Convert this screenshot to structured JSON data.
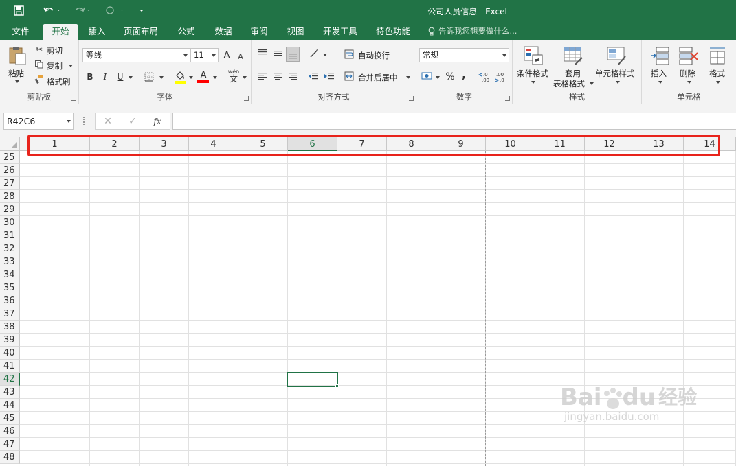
{
  "window": {
    "title": "公司人员信息 - Excel"
  },
  "qat": {
    "save": "save-icon",
    "undo": "undo-icon",
    "redo": "redo-icon",
    "touch": "touch-mode-icon",
    "customize": "customize-icon"
  },
  "tabs": [
    "文件",
    "开始",
    "插入",
    "页面布局",
    "公式",
    "数据",
    "审阅",
    "视图",
    "开发工具",
    "特色功能"
  ],
  "tell_me": "告诉我您想要做什么...",
  "ribbon": {
    "clipboard": {
      "label": "剪贴板",
      "paste": "粘贴",
      "cut": "剪切",
      "copy": "复制",
      "format_painter": "格式刷"
    },
    "font": {
      "label": "字体",
      "name": "等线",
      "size": "11",
      "grow": "A",
      "shrink": "A",
      "bold": "B",
      "italic": "I",
      "underline": "U",
      "highlight_color": "#ffff00",
      "font_color_letter": "A",
      "font_color": "#ff0000",
      "wen": "wén",
      "wen2": "文"
    },
    "alignment": {
      "label": "对齐方式",
      "wrap": "自动换行",
      "merge": "合并后居中"
    },
    "number": {
      "label": "数字",
      "format": "常规",
      "percent": "%",
      "comma": ",",
      "inc": "←.0\n.00",
      "dec": ".00\n→.0"
    },
    "styles": {
      "label": "样式",
      "conditional": "条件格式",
      "table_line1": "套用",
      "table_line2": "表格格式",
      "cell_styles": "单元格样式"
    },
    "cells": {
      "label": "单元格",
      "insert": "插入",
      "delete": "删除",
      "format": "格式"
    }
  },
  "formula_bar": {
    "name_box": "R42C6",
    "cancel": "✕",
    "enter": "✓",
    "fx": "fx",
    "value": ""
  },
  "sheet": {
    "columns": [
      "1",
      "2",
      "3",
      "4",
      "5",
      "6",
      "7",
      "8",
      "9",
      "10",
      "11",
      "12",
      "13",
      "14"
    ],
    "selected_column": "6",
    "rows": [
      "25",
      "26",
      "27",
      "28",
      "29",
      "30",
      "31",
      "32",
      "33",
      "34",
      "35",
      "36",
      "37",
      "38",
      "39",
      "40",
      "41",
      "42",
      "43",
      "44",
      "45",
      "46",
      "47",
      "48"
    ],
    "selected_row": "42"
  },
  "watermark": {
    "brand": "Bai",
    "brand2": "du",
    "brand3": "经验",
    "url": "jingyan.baidu.com"
  },
  "colors": {
    "accent": "#217346",
    "highlight_box": "#e8231b"
  }
}
